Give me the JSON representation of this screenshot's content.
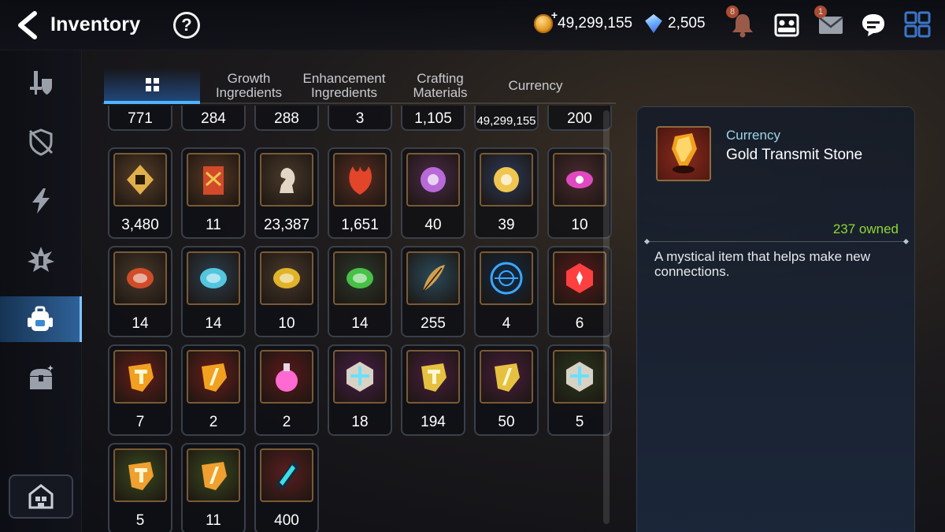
{
  "header": {
    "title": "Inventory",
    "help_label": "?",
    "gold": "49,299,155",
    "gems": "2,505",
    "plus_sign": "+",
    "notifications_badge": "8",
    "mail_badge": "1"
  },
  "sidebar": {
    "items": [
      {
        "name": "equipment",
        "icon": "sword-shield-icon"
      },
      {
        "name": "artifacts",
        "icon": "shield-icon"
      },
      {
        "name": "catalysts",
        "icon": "lightning-icon"
      },
      {
        "name": "imprint",
        "icon": "burst-icon"
      },
      {
        "name": "items",
        "icon": "backpack-icon",
        "active": true
      },
      {
        "name": "chests",
        "icon": "chest-icon"
      }
    ],
    "home_icon": "home-icon"
  },
  "tabs": [
    {
      "label": "",
      "icon": "grid-icon",
      "active": true
    },
    {
      "label": "Growth Ingredients"
    },
    {
      "label": "Enhancement Ingredients"
    },
    {
      "label": "Crafting Materials"
    },
    {
      "label": "Currency"
    }
  ],
  "items_partial_row": [
    "771",
    "284",
    "288",
    "3",
    "1,105",
    "49,299,155",
    "200"
  ],
  "items": [
    {
      "qty": "3,480",
      "icon": "fist-emblem-icon",
      "bg": "#5a4028",
      "accent": "#e0b04a"
    },
    {
      "qty": "11",
      "icon": "banner-icon",
      "bg": "#5a3a24",
      "accent": "#d24a2a"
    },
    {
      "qty": "23,387",
      "icon": "knight-chess-icon",
      "bg": "#4a3a2c",
      "accent": "#e2d6c6"
    },
    {
      "qty": "1,651",
      "icon": "flame-leaf-icon",
      "bg": "#5a2e22",
      "accent": "#e2452a"
    },
    {
      "qty": "40",
      "icon": "purple-flower-icon",
      "bg": "#4a2a48",
      "accent": "#b86ad8"
    },
    {
      "qty": "39",
      "icon": "gold-flower-icon",
      "bg": "#2c3a5a",
      "accent": "#f0c650"
    },
    {
      "qty": "10",
      "icon": "purple-eye-icon",
      "bg": "#4a2a30",
      "accent": "#e04ac0"
    },
    {
      "qty": "14",
      "icon": "red-rune-icon",
      "bg": "#4a3a2c",
      "accent": "#e0502a"
    },
    {
      "qty": "14",
      "icon": "ice-rune-icon",
      "bg": "#2c3e4e",
      "accent": "#58d6f0"
    },
    {
      "qty": "10",
      "icon": "light-rune-icon",
      "bg": "#4a3a2c",
      "accent": "#f2c22a"
    },
    {
      "qty": "14",
      "icon": "earth-rune-icon",
      "bg": "#2c3a2c",
      "accent": "#4ad04a"
    },
    {
      "qty": "255",
      "icon": "feather-icon",
      "bg": "#2a4a5a",
      "accent": "#d0a050"
    },
    {
      "qty": "4",
      "icon": "blue-sigil-icon",
      "bg": "#122a44",
      "accent": "#3aa8ff"
    },
    {
      "qty": "6",
      "icon": "red-crystal-icon",
      "bg": "#5a1a1a",
      "accent": "#ff4040"
    },
    {
      "qty": "7",
      "icon": "red-stone-t-icon",
      "bg": "#6a1e1a",
      "accent": "#f2a020"
    },
    {
      "qty": "2",
      "icon": "red-stone-slash-icon",
      "bg": "#6a1e1a",
      "accent": "#f2a020"
    },
    {
      "qty": "2",
      "icon": "potion-icon",
      "bg": "#5a1a1a",
      "accent": "#ff6ad2"
    },
    {
      "qty": "18",
      "icon": "purple-cross-stone-icon",
      "bg": "#4a1e4a",
      "accent": "#6ae0ff"
    },
    {
      "qty": "194",
      "icon": "purple-stone-t-icon",
      "bg": "#4a1e3e",
      "accent": "#e6c040"
    },
    {
      "qty": "50",
      "icon": "purple-stone-slash-icon",
      "bg": "#4a1e3e",
      "accent": "#e6c040"
    },
    {
      "qty": "5",
      "icon": "green-cross-stone-icon",
      "bg": "#2a3a1e",
      "accent": "#6ae0ff"
    },
    {
      "qty": "5",
      "icon": "green-stone-t-icon",
      "bg": "#3a4a1e",
      "accent": "#f0a030"
    },
    {
      "qty": "11",
      "icon": "green-stone-slash-icon",
      "bg": "#3a4a1e",
      "accent": "#f0a030"
    },
    {
      "qty": "400",
      "icon": "dark-shard-icon",
      "bg": "#5a1e1e",
      "accent": "#3ae0e6"
    }
  ],
  "detail": {
    "category": "Currency",
    "name": "Gold Transmit Stone",
    "owned": "237 owned",
    "description": "A mystical item that helps make new connections.",
    "icon": "gold-transmit-stone-icon"
  },
  "colors": {
    "accent_blue": "#4fb4ff",
    "owned_green": "#8fd636",
    "category_cyan": "#9cd6ea",
    "frame_bronze": "#7a5a34"
  }
}
